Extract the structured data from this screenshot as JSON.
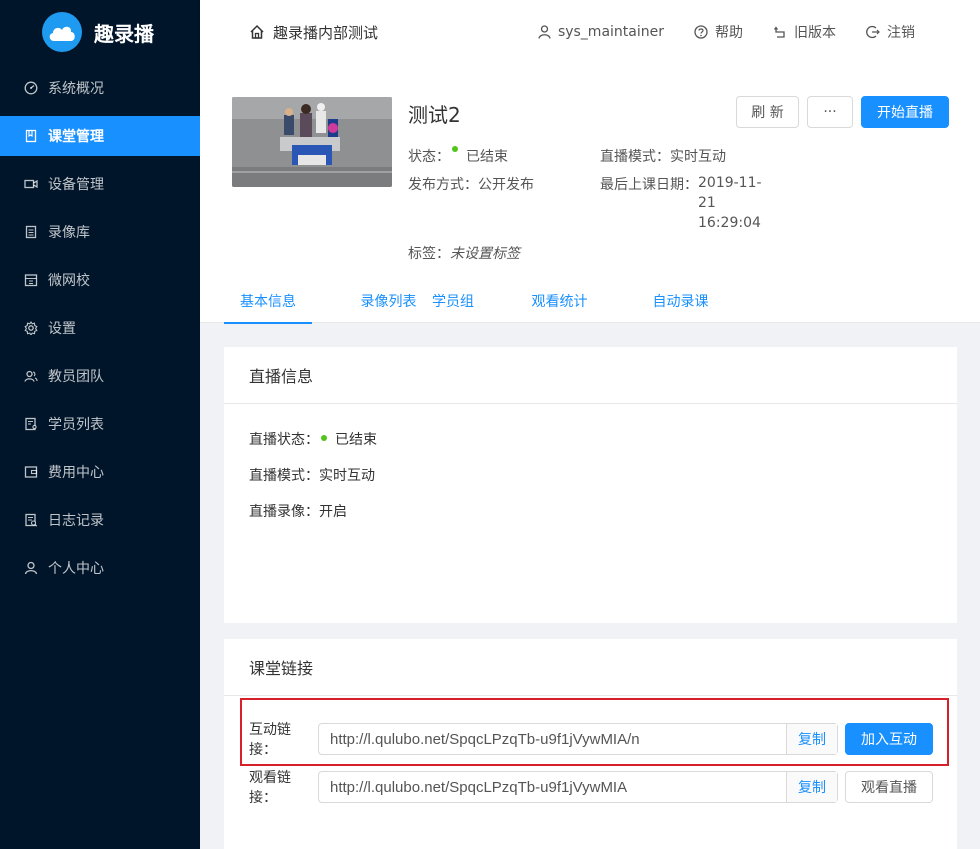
{
  "app": {
    "name": "趣录播",
    "org_title": "趣录播内部测试"
  },
  "header": {
    "user": "sys_maintainer",
    "help": "帮助",
    "old_version": "旧版本",
    "logout": "注销"
  },
  "sidebar": {
    "items": [
      {
        "label": "系统概况",
        "icon": "dashboard-icon",
        "active": false
      },
      {
        "label": "课堂管理",
        "icon": "book-icon",
        "active": true
      },
      {
        "label": "设备管理",
        "icon": "video-camera-icon",
        "active": false
      },
      {
        "label": "录像库",
        "icon": "database-icon",
        "active": false
      },
      {
        "label": "微网校",
        "icon": "school-icon",
        "active": false
      },
      {
        "label": "设置",
        "icon": "gear-icon",
        "active": false
      },
      {
        "label": "教员团队",
        "icon": "team-icon",
        "active": false
      },
      {
        "label": "学员列表",
        "icon": "student-list-icon",
        "active": false
      },
      {
        "label": "费用中心",
        "icon": "wallet-icon",
        "active": false
      },
      {
        "label": "日志记录",
        "icon": "log-icon",
        "active": false
      },
      {
        "label": "个人中心",
        "icon": "user-icon",
        "active": false
      }
    ]
  },
  "course": {
    "title": "测试2",
    "status_label": "状态：",
    "status_value": "已结束",
    "publish_label": "发布方式：",
    "publish_value": "公开发布",
    "mode_label": "直播模式：",
    "mode_value": "实时互动",
    "last_date_label": "最后上课日期：",
    "last_date_line1": "2019-11-",
    "last_date_line2": "21",
    "last_date_line3": "16:29:04",
    "tags_label": "标签：",
    "tags_value": "未设置标签"
  },
  "actions": {
    "refresh": "刷 新",
    "more": "···",
    "start_live": "开始直播"
  },
  "tabs": [
    {
      "label": "基本信息",
      "active": true
    },
    {
      "label": "录像列表",
      "active": false
    },
    {
      "label": "学员组",
      "active": false
    },
    {
      "label": "观看统计",
      "active": false
    },
    {
      "label": "自动录课",
      "active": false
    }
  ],
  "live_info": {
    "title": "直播信息",
    "status_label": "直播状态：",
    "status_value": "已结束",
    "mode_label": "直播模式：",
    "mode_value": "实时互动",
    "record_label": "直播录像：",
    "record_value": "开启"
  },
  "class_links": {
    "title": "课堂链接",
    "interactive_label": "互动链接：",
    "interactive_url": "http://l.qulubo.net/SpqcLPzqTb-u9f1jVywMIA/n",
    "interactive_copy": "复制",
    "interactive_join": "加入互动",
    "watch_label": "观看链接：",
    "watch_url": "http://l.qulubo.net/SpqcLPzqTb-u9f1jVywMIA",
    "watch_copy": "复制",
    "watch_live": "观看直播"
  },
  "colors": {
    "sidebar_bg": "#001529",
    "primary": "#1890ff",
    "success_dot": "#52c41a",
    "highlight": "#d9202a"
  }
}
